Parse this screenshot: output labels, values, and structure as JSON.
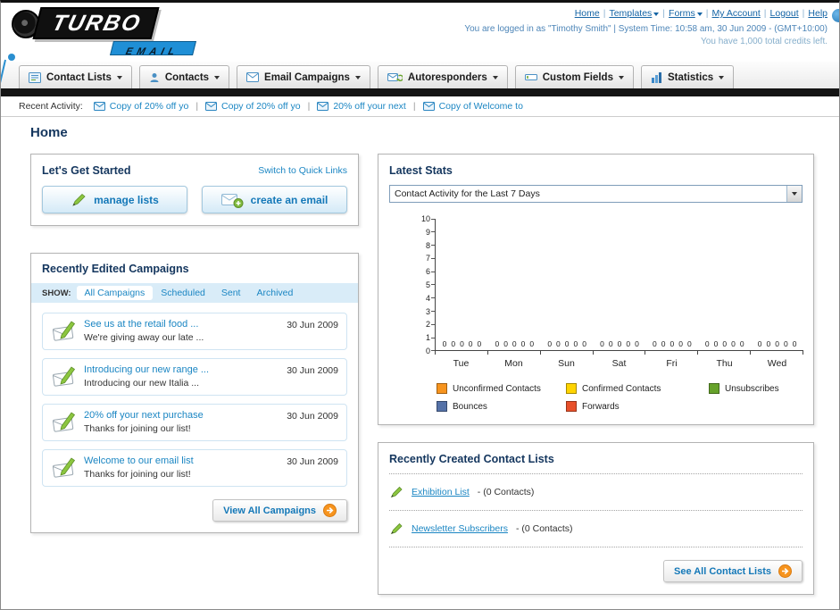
{
  "header": {
    "logo_main": "TURBO",
    "logo_sub": "EMAIL",
    "separator": "|",
    "links": [
      {
        "label": "Home",
        "dropdown": false
      },
      {
        "label": "Templates",
        "dropdown": true
      },
      {
        "label": "Forms",
        "dropdown": true
      },
      {
        "label": "My Account",
        "dropdown": false
      },
      {
        "label": "Logout",
        "dropdown": false
      },
      {
        "label": "Help",
        "dropdown": false
      }
    ],
    "login_line": "You are logged in as \"Timothy Smith\" | System Time: 10:58 am, 30 Jun 2009 - (GMT+10:00)",
    "credits_line": "You have 1,000 total credits left."
  },
  "nav": {
    "items": [
      {
        "label": "Contact Lists"
      },
      {
        "label": "Contacts"
      },
      {
        "label": "Email Campaigns"
      },
      {
        "label": "Autoresponders"
      },
      {
        "label": "Custom Fields"
      },
      {
        "label": "Statistics"
      }
    ]
  },
  "recent_activity": {
    "label": "Recent Activity:",
    "separator": "|",
    "items": [
      "Copy of 20% off yo",
      "Copy of 20% off yo",
      "20% off your next",
      "Copy of Welcome to"
    ]
  },
  "page": {
    "title": "Home"
  },
  "get_started": {
    "title": "Let's Get Started",
    "switch_link": "Switch to Quick Links",
    "manage_lists_label": "manage lists",
    "create_email_label": "create an email"
  },
  "campaigns": {
    "title": "Recently Edited Campaigns",
    "show_label": "SHOW:",
    "tabs": [
      "All Campaigns",
      "Scheduled",
      "Sent",
      "Archived"
    ],
    "items": [
      {
        "title": "See us at the retail food ...",
        "subtitle": "We're giving away our late ...",
        "date": "30 Jun 2009"
      },
      {
        "title": "Introducing our new range ...",
        "subtitle": "Introducing our new Italia ...",
        "date": "30 Jun 2009"
      },
      {
        "title": "20% off your next purchase",
        "subtitle": "Thanks for joining our list!",
        "date": "30 Jun 2009"
      },
      {
        "title": "Welcome to our email list",
        "subtitle": "Thanks for joining our list!",
        "date": "30 Jun 2009"
      }
    ],
    "view_all_label": "View All Campaigns"
  },
  "stats": {
    "title": "Latest Stats",
    "dropdown_value": "Contact Activity for the Last 7 Days"
  },
  "chart_data": {
    "type": "bar",
    "title": "Contact Activity for the Last 7 Days",
    "categories": [
      "Tue",
      "Mon",
      "Sun",
      "Sat",
      "Fri",
      "Thu",
      "Wed"
    ],
    "series": [
      {
        "name": "Unconfirmed Contacts",
        "color": "#F7941E",
        "values": [
          0,
          0,
          0,
          0,
          0,
          0,
          0
        ]
      },
      {
        "name": "Confirmed Contacts",
        "color": "#FFD400",
        "values": [
          0,
          0,
          0,
          0,
          0,
          0,
          0
        ]
      },
      {
        "name": "Unsubscribes",
        "color": "#66A22A",
        "values": [
          0,
          0,
          0,
          0,
          0,
          0,
          0
        ]
      },
      {
        "name": "Bounces",
        "color": "#5572A8",
        "values": [
          0,
          0,
          0,
          0,
          0,
          0,
          0
        ]
      },
      {
        "name": "Forwards",
        "color": "#E8502A",
        "values": [
          0,
          0,
          0,
          0,
          0,
          0,
          0
        ]
      }
    ],
    "ylim": [
      0,
      10
    ],
    "ytick_step": 1,
    "grid": false,
    "legend_position": "bottom",
    "xlabel": "",
    "ylabel": ""
  },
  "contact_lists": {
    "title": "Recently Created Contact Lists",
    "items": [
      {
        "name": "Exhibition List",
        "count": "- (0 Contacts)"
      },
      {
        "name": "Newsletter Subscribers",
        "count": "- (0 Contacts)"
      }
    ],
    "see_all_label": "See All Contact Lists"
  }
}
